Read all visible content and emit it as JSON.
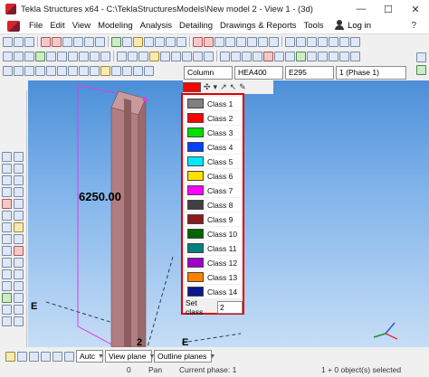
{
  "window": {
    "title": "Tekla Structures x64 - C:\\TeklaStructuresModels\\New model 2  - View 1 - (3d)",
    "minimize": "—",
    "maximize": "☐",
    "close": "✕"
  },
  "menu": {
    "items": [
      "File",
      "Edit",
      "View",
      "Modeling",
      "Analysis",
      "Detailing",
      "Drawings & Reports",
      "Tools"
    ],
    "login_label": "Log in",
    "help_label": "?"
  },
  "properties": {
    "profile_type": "Column",
    "profile": "HEA400",
    "material": "E295",
    "phase": "1 (Phase 1)"
  },
  "viewport": {
    "dimension_label": "6250.00",
    "axis_label_left": "E",
    "axis_label_bottom": "E",
    "grid_label_2": "2",
    "coord_x": "x",
    "coord_y": "y",
    "coord_z": "z"
  },
  "class_panel": {
    "items": [
      {
        "label": "Class 1",
        "color": "#808080"
      },
      {
        "label": "Class 2",
        "color": "#ff0000"
      },
      {
        "label": "Class 3",
        "color": "#00e000"
      },
      {
        "label": "Class 4",
        "color": "#0040ff"
      },
      {
        "label": "Class 5",
        "color": "#00e8ff"
      },
      {
        "label": "Class 6",
        "color": "#ffe000"
      },
      {
        "label": "Class 7",
        "color": "#ff00ff"
      },
      {
        "label": "Class 8",
        "color": "#404040"
      },
      {
        "label": "Class 9",
        "color": "#8b1a1a"
      },
      {
        "label": "Class 10",
        "color": "#006400"
      },
      {
        "label": "Class 11",
        "color": "#008080"
      },
      {
        "label": "Class 12",
        "color": "#a000c8"
      },
      {
        "label": "Class 13",
        "color": "#ff8000"
      },
      {
        "label": "Class 14",
        "color": "#0a1a8a"
      }
    ],
    "set_class_label": "Set class",
    "set_class_value": "2"
  },
  "status_toolbar": {
    "snap_mode": "Autc",
    "view_plane": "View plane",
    "outline_planes": "Outline planes"
  },
  "statusbar": {
    "coord": "0",
    "mode": "Pan",
    "current_phase": "Current phase: 1",
    "selection": "1 + 0 object(s) selected"
  },
  "colors": {
    "highlight": "#e00000",
    "viewport_top": "#4c8fd8",
    "column_fill": "#b07d80"
  }
}
